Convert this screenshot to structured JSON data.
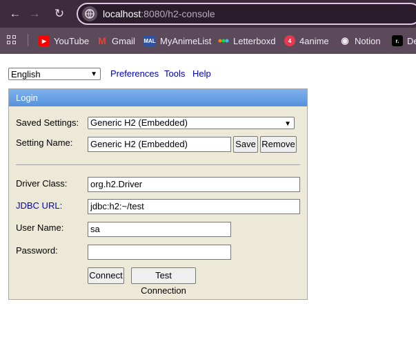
{
  "browser": {
    "url_host": "localhost",
    "url_path": ":8080/h2-console",
    "bookmarks": [
      {
        "label": "YouTube",
        "icon": "youtube-icon",
        "color": "#ff0000"
      },
      {
        "label": "Gmail",
        "icon": "gmail-icon",
        "color": "#ea4335"
      },
      {
        "label": "MyAnimeList",
        "icon": "myanimelist-icon",
        "color": "#2e51a2",
        "badge": "MAL"
      },
      {
        "label": "Letterboxd",
        "icon": "letterboxd-icon",
        "color": "#00c030"
      },
      {
        "label": "4anime",
        "icon": "4anime-icon",
        "color": "#e8384f",
        "badge": "4"
      },
      {
        "label": "Notion",
        "icon": "notion-icon",
        "color": "#ffffff"
      },
      {
        "label": "De",
        "icon": "raycast-icon",
        "color": "#000000",
        "badge": "r."
      }
    ]
  },
  "toolbar": {
    "language": "English",
    "preferences": "Preferences",
    "tools": "Tools",
    "help": "Help"
  },
  "login": {
    "header": "Login",
    "saved_settings_label": "Saved Settings:",
    "saved_settings_value": "Generic H2 (Embedded)",
    "setting_name_label": "Setting Name:",
    "setting_name_value": "Generic H2 (Embedded)",
    "save_label": "Save",
    "remove_label": "Remove",
    "driver_class_label": "Driver Class:",
    "driver_class_value": "org.h2.Driver",
    "jdbc_url_label": "JDBC URL:",
    "jdbc_url_value": "jdbc:h2:~/test",
    "user_name_label": "User Name:",
    "user_name_value": "sa",
    "password_label": "Password:",
    "password_value": "",
    "connect_label": "Connect",
    "test_connection_label": "Test Connection"
  },
  "colors": {
    "panel_bg": "#ece9d8",
    "header_blue": "#5592dd",
    "link": "#0000cc"
  }
}
